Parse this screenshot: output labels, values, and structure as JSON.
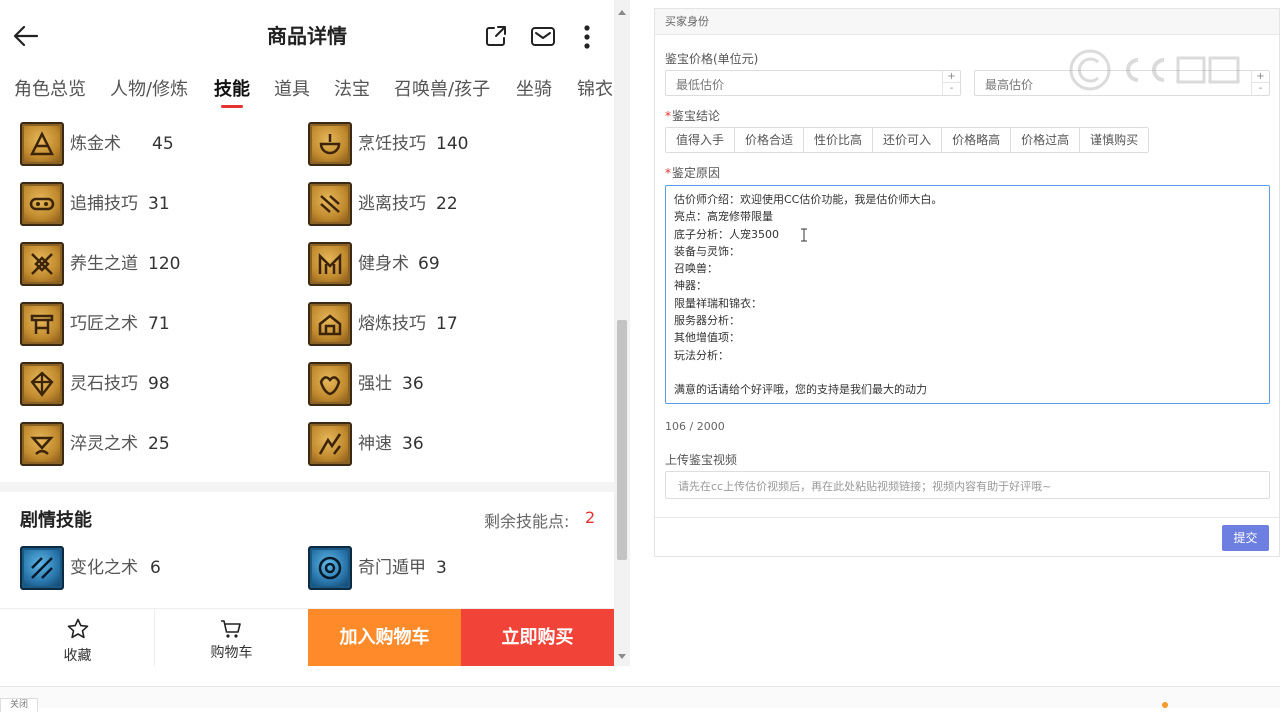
{
  "header": {
    "title": "商品详情"
  },
  "tabs": [
    {
      "label": "角色总览"
    },
    {
      "label": "人物/修炼"
    },
    {
      "label": "技能"
    },
    {
      "label": "道具"
    },
    {
      "label": "法宝"
    },
    {
      "label": "召唤兽/孩子"
    },
    {
      "label": "坐骑"
    },
    {
      "label": "锦衣"
    }
  ],
  "active_tab": "技能",
  "life_skills": [
    {
      "name": "炼金术",
      "level": "45"
    },
    {
      "name": "烹饪技巧",
      "level": "140"
    },
    {
      "name": "追捕技巧",
      "level": "31"
    },
    {
      "name": "逃离技巧",
      "level": "22"
    },
    {
      "name": "养生之道",
      "level": "120"
    },
    {
      "name": "健身术",
      "level": "69"
    },
    {
      "name": "巧匠之术",
      "level": "71"
    },
    {
      "name": "熔炼技巧",
      "level": "17"
    },
    {
      "name": "灵石技巧",
      "level": "98"
    },
    {
      "name": "强壮",
      "level": "36"
    },
    {
      "name": "淬灵之术",
      "level": "25"
    },
    {
      "name": "神速",
      "level": "36"
    }
  ],
  "story_skills": {
    "title": "剧情技能",
    "remaining_label": "剩余技能点:",
    "remaining_value": "2",
    "items": [
      {
        "name": "变化之术",
        "level": "6"
      },
      {
        "name": "奇门遁甲",
        "level": "3"
      }
    ]
  },
  "bottom_bar": {
    "favorite": "收藏",
    "cart": "购物车",
    "add_to_cart": "加入购物车",
    "buy_now": "立即购买"
  },
  "form": {
    "header": "买家身份",
    "price_label": "鉴宝价格(单位元)",
    "min_placeholder": "最低估价",
    "max_placeholder": "最高估价",
    "spin_up": "+",
    "spin_down": "-",
    "conclusion_label": "鉴宝结论",
    "conclusion_options": [
      "值得入手",
      "价格合适",
      "性价比高",
      "还价可入",
      "价格略高",
      "价格过高",
      "谨慎购买"
    ],
    "reason_label": "鉴定原因",
    "reason_lines": [
      "估价师介绍：欢迎使用CC估价功能，我是估价师大白。",
      "亮点：高宠修带限量",
      "底子分析：人宠3500",
      "装备与灵饰：",
      "召唤兽：",
      "神器：",
      "限量祥瑞和锦衣：",
      "服务器分析：",
      "其他增值项：",
      "玩法分析：",
      "",
      "满意的话请给个好评哦，您的支持是我们最大的动力"
    ],
    "char_count": "106 / 2000",
    "video_label": "上传鉴宝视频",
    "video_placeholder": "请先在cc上传估价视频后，再在此处粘贴视频链接；视频内容有助于好评哦~",
    "submit": "提交",
    "required_mark": "*"
  },
  "watermark": "CC直播",
  "bottom_strip": {
    "close_label": "关闭"
  }
}
